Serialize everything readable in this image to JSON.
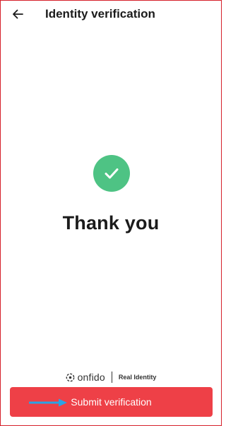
{
  "header": {
    "title": "Identity verification",
    "back_icon": "arrow-left-icon"
  },
  "status": {
    "icon": "checkmark-icon",
    "icon_color": "#4ec384",
    "message": "Thank you"
  },
  "branding": {
    "logo_icon": "onfido-logo-icon",
    "name": "onfido",
    "tagline": "Real Identity"
  },
  "footer": {
    "submit_label": "Submit verification",
    "button_color": "#ee4047",
    "annotation_arrow_icon": "arrow-right-icon",
    "annotation_color": "#2aa3e6"
  },
  "frame": {
    "border_color": "#d5202a"
  }
}
